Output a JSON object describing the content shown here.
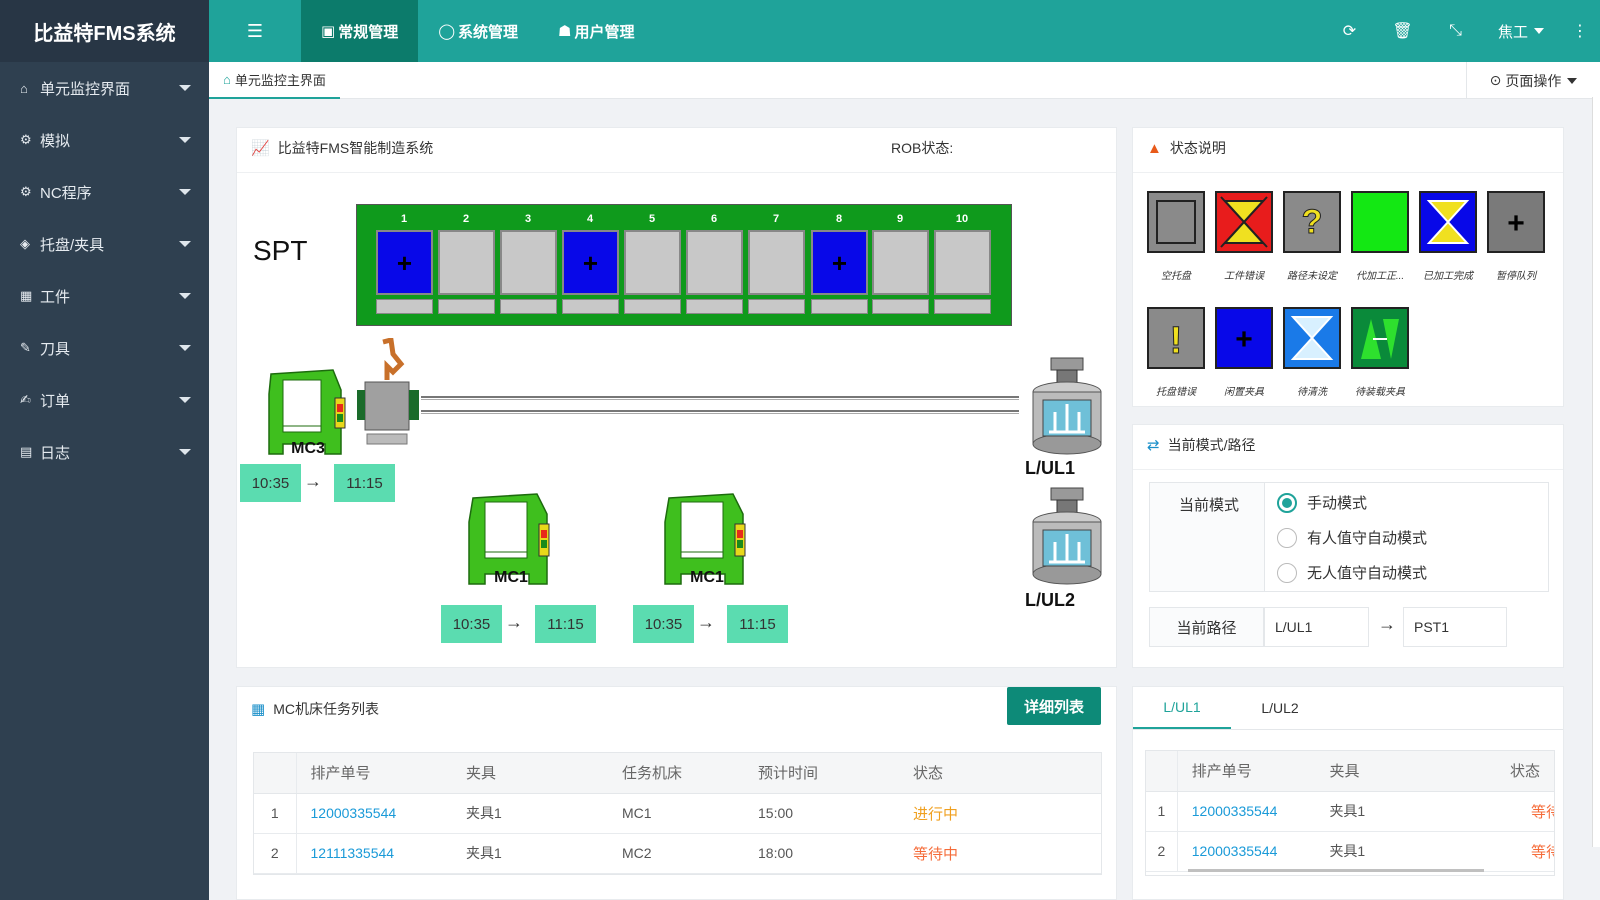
{
  "app": {
    "title": "比益特FMS系统"
  },
  "sidebar": {
    "items": [
      {
        "label": "单元监控界面",
        "icon": "home-icon",
        "glyph": "⌂"
      },
      {
        "label": "模拟",
        "icon": "cogs-icon",
        "glyph": "⚙"
      },
      {
        "label": "NC程序",
        "icon": "cogs-icon",
        "glyph": "⚙"
      },
      {
        "label": "托盘/夹具",
        "icon": "cube-icon",
        "glyph": "◈"
      },
      {
        "label": "工件",
        "icon": "calendar-icon",
        "glyph": "▦"
      },
      {
        "label": "刀具",
        "icon": "eraser-icon",
        "glyph": "✎"
      },
      {
        "label": "订单",
        "icon": "edit-icon",
        "glyph": "✍"
      },
      {
        "label": "日志",
        "icon": "file-icon",
        "glyph": "▤"
      }
    ]
  },
  "topbar": {
    "tabs": [
      {
        "label": "常规管理",
        "icon": "user-card-icon",
        "glyph": "▣",
        "active": true
      },
      {
        "label": "系统管理",
        "icon": "circle-icon",
        "glyph": "◯"
      },
      {
        "label": "用户管理",
        "icon": "users-icon",
        "glyph": "☗"
      }
    ],
    "user": "焦工"
  },
  "tabbar": {
    "page_tab": "单元监控主界面",
    "page_ops": "页面操作"
  },
  "monitor": {
    "title": "比益特FMS智能制造系统",
    "rob_status": "ROB状态:",
    "spt_label": "SPT",
    "slots": [
      {
        "num": "1",
        "state": "blue"
      },
      {
        "num": "2",
        "state": "empty"
      },
      {
        "num": "3",
        "state": "empty"
      },
      {
        "num": "4",
        "state": "blue"
      },
      {
        "num": "5",
        "state": "empty"
      },
      {
        "num": "6",
        "state": "empty"
      },
      {
        "num": "7",
        "state": "empty"
      },
      {
        "num": "8",
        "state": "blue"
      },
      {
        "num": "9",
        "state": "empty"
      },
      {
        "num": "10",
        "state": "empty"
      }
    ],
    "machines": [
      {
        "name": "MC3",
        "start": "10:35",
        "end": "11:15"
      },
      {
        "name": "MC1",
        "start": "10:35",
        "end": "11:15"
      },
      {
        "name": "MC1",
        "start": "10:35",
        "end": "11:15"
      }
    ],
    "arrow": "→",
    "lul1": "L/UL1",
    "lul2": "L/UL2"
  },
  "legend": {
    "title": "状态说明",
    "items": [
      {
        "label": "空托盘",
        "color": "#8a8a8a",
        "symbol": "empty"
      },
      {
        "label": "工件错误",
        "color": "#e81c1c",
        "symbol": "x-hourglass"
      },
      {
        "label": "路径未设定",
        "color": "#8a8a8a",
        "symbol": "question"
      },
      {
        "label": "代加工正...",
        "color": "#13e813",
        "symbol": "solid"
      },
      {
        "label": "已加工完成",
        "color": "#0808e8",
        "symbol": "hourglass"
      },
      {
        "label": "暂停队列",
        "color": "#7a7a7a",
        "symbol": "plus"
      },
      {
        "label": "托盘错误",
        "color": "#8a8a8a",
        "symbol": "exclaim"
      },
      {
        "label": "闲置夹具",
        "color": "#0808e8",
        "symbol": "plus"
      },
      {
        "label": "待清洗",
        "color": "#1a7ae8",
        "symbol": "hourglass-blue"
      },
      {
        "label": "待装载夹具",
        "color": "#0a8a3a",
        "symbol": "load"
      }
    ]
  },
  "mode": {
    "title": "当前模式/路径",
    "mode_label": "当前模式",
    "options": [
      {
        "label": "手动模式",
        "checked": true
      },
      {
        "label": "有人值守自动模式",
        "checked": false
      },
      {
        "label": "无人值守自动模式",
        "checked": false
      }
    ],
    "path_label": "当前路径",
    "path_from": "L/UL1",
    "path_to": "PST1",
    "arrow": "→"
  },
  "mc_tasks": {
    "title": "MC机床任务列表",
    "detail_button": "详细列表",
    "columns": [
      "排产单号",
      "夹具",
      "任务机床",
      "预计时间",
      "状态"
    ],
    "rows": [
      {
        "no": "1",
        "order": "12000335544",
        "fixture": "夹具1",
        "machine": "MC1",
        "time": "15:00",
        "status": "进行中",
        "status_color": "#f0a020"
      },
      {
        "no": "2",
        "order": "12111335544",
        "fixture": "夹具1",
        "machine": "MC2",
        "time": "18:00",
        "status": "等待中",
        "status_color": "#f56c3a"
      }
    ]
  },
  "lul_tasks": {
    "tabs": [
      "L/UL1",
      "L/UL2"
    ],
    "columns": [
      "排产单号",
      "夹具",
      "状态"
    ],
    "rows": [
      {
        "no": "1",
        "order": "12000335544",
        "fixture": "夹具1",
        "status": "等待中"
      },
      {
        "no": "2",
        "order": "12000335544",
        "fixture": "夹具1",
        "status": "等待中"
      }
    ]
  }
}
